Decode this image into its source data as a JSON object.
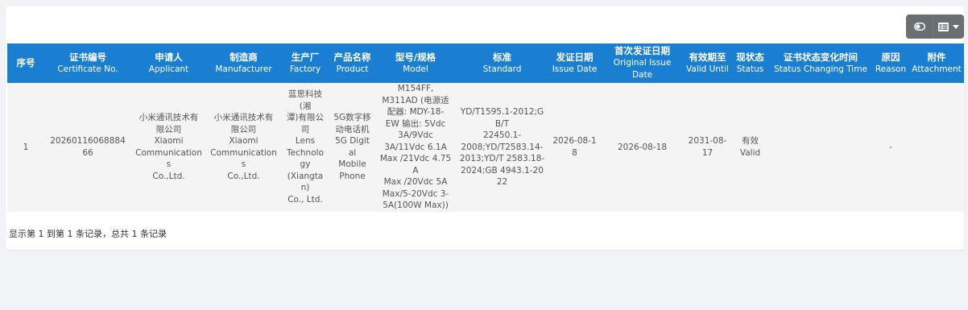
{
  "toolbar": {
    "toggle_icon": "toggle-icon",
    "columns_icon": "columns-icon",
    "dropdown_icon": "caret-down-icon"
  },
  "table": {
    "headers": [
      {
        "zh": "序号",
        "en": ""
      },
      {
        "zh": "证书编号",
        "en": "Certificate No."
      },
      {
        "zh": "申请人",
        "en": "Applicant"
      },
      {
        "zh": "制造商",
        "en": "Manufacturer"
      },
      {
        "zh": "生产厂",
        "en": "Factory"
      },
      {
        "zh": "产品名称",
        "en": "Product"
      },
      {
        "zh": "型号/规格",
        "en": "Model"
      },
      {
        "zh": "标准",
        "en": "Standard"
      },
      {
        "zh": "发证日期",
        "en": "Issue Date"
      },
      {
        "zh": "首次发证日期",
        "en": "Original Issue Date"
      },
      {
        "zh": "有效期至",
        "en": "Valid Until"
      },
      {
        "zh": "现状态",
        "en": "Status"
      },
      {
        "zh": "证书状态变化时间",
        "en": "Status Changing Time"
      },
      {
        "zh": "原因",
        "en": "Reason"
      },
      {
        "zh": "附件",
        "en": "Attachment"
      }
    ],
    "rows": [
      {
        "index": "1",
        "certificate_no": "2026011606888466",
        "applicant": "小米通讯技术有\n限公司\nXiaomi\nCommunications\nCo.,Ltd.",
        "manufacturer": "小米通讯技术有\n限公司\nXiaomi\nCommunications\nCo.,Ltd.",
        "factory": "蓝思科技(湘\n潭)有限公司\nLens\nTechnology\n(Xiangtan)\nCo., Ltd.",
        "product": "5G数字移\n动电话机\n5G Digital\nMobile\nPhone",
        "model": "M154FF,\nM311AD (电源适\n配器: MDY-18-\nEW 输出: 5Vdc\n3A/9Vdc\n3A/11Vdc 6.1A\nMax /21Vdc 4.75A\nMax /20Vdc 5A\nMax/5-20Vdc 3-\n5A(100W Max))",
        "standard": "YD/T1595.1-2012;GB/T\n22450.1-\n2008;YD/T2583.14-\n2013;YD/T 2583.18-\n2024;GB 4943.1-2022",
        "issue_date": "2026-08-18",
        "original_issue_date": "2026-08-18",
        "valid_until": "2031-08-\n17",
        "status": "有效\nValid",
        "status_changing_time": "",
        "reason": "-",
        "attachment": ""
      }
    ]
  },
  "footer": {
    "summary": "显示第 1 到第 1 条记录，总共 1 条记录"
  },
  "colors": {
    "header_bg": "#1b7fd1",
    "row_bg": "#f4f4f4",
    "toolbar_bg": "#6a6f73"
  }
}
